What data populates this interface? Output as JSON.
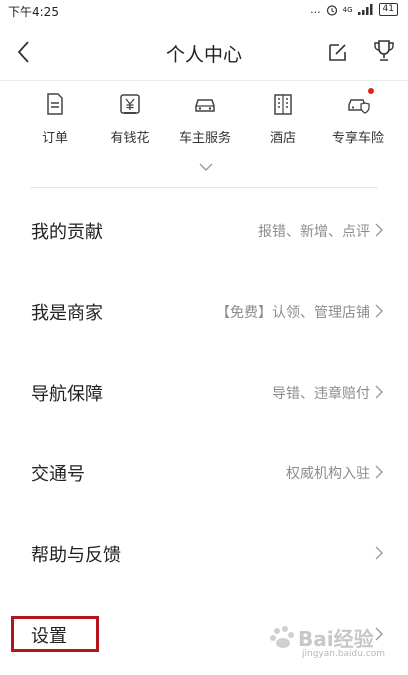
{
  "status_bar": {
    "time": "下午4:25",
    "dots": "...",
    "network": "4G",
    "battery": "41"
  },
  "header": {
    "title": "个人中心",
    "icons": [
      "back-arrow-icon",
      "edit-icon",
      "trophy-icon"
    ]
  },
  "shortcuts": [
    {
      "label": "订单",
      "icon": "document-icon"
    },
    {
      "label": "有钱花",
      "icon": "yuan-icon"
    },
    {
      "label": "车主服务",
      "icon": "car-icon"
    },
    {
      "label": "酒店",
      "icon": "building-icon"
    },
    {
      "label": "专享车险",
      "icon": "car-shield-icon",
      "badge": true
    }
  ],
  "menu": [
    {
      "title": "我的贡献",
      "hint": "报错、新增、点评"
    },
    {
      "title": "我是商家",
      "hint": "【免费】认领、管理店铺"
    },
    {
      "title": "导航保障",
      "hint": "导错、违章赔付"
    },
    {
      "title": "交通号",
      "hint": "权威机构入驻"
    },
    {
      "title": "帮助与反馈",
      "hint": ""
    },
    {
      "title": "设置",
      "hint": ""
    }
  ],
  "watermark": {
    "text": "Bai经验",
    "sub": "jingyan.baidu.com"
  },
  "colors": {
    "highlight": "#b3141c",
    "badge": "#e2231a",
    "hint": "#8c8c8c"
  }
}
